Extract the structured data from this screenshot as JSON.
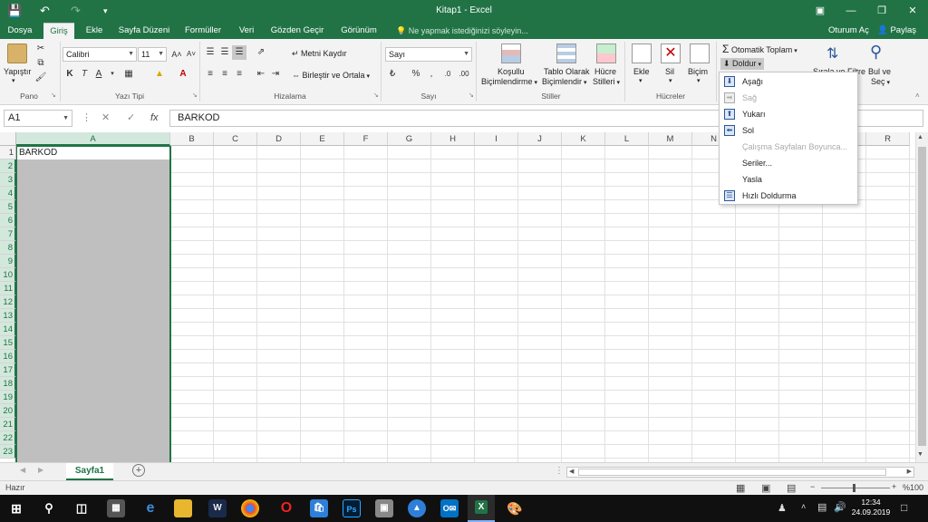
{
  "titlebar": {
    "title": "Kitap1  -  Excel"
  },
  "ribbon_tabs": [
    "Dosya",
    "Giriş",
    "Ekle",
    "Sayfa Düzeni",
    "Formüller",
    "Veri",
    "Gözden Geçir",
    "Görünüm"
  ],
  "tell_me": "Ne yapmak istediğinizi söyleyin...",
  "signin": "Oturum Aç",
  "share": "Paylaş",
  "ribbon": {
    "paste": "Yapıştır",
    "clipboard_label": "Pano",
    "font_name": "Calibri",
    "font_size": "11",
    "bold": "K",
    "italic": "T",
    "underline": "A",
    "font_label": "Yazı Tipi",
    "wrap_text": "Metni Kaydır",
    "merge_center": "Birleştir ve Ortala",
    "alignment_label": "Hizalama",
    "number_format": "Sayı",
    "number_label": "Sayı",
    "conditional_1": "Koşullu",
    "conditional_2": "Biçimlendirme",
    "table_1": "Tablo Olarak",
    "table_2": "Biçimlendir",
    "cellstyles_1": "Hücre",
    "cellstyles_2": "Stilleri",
    "styles_label": "Stiller",
    "insert": "Ekle",
    "delete": "Sil",
    "format": "Biçim",
    "cells_label": "Hücreler",
    "autosum": "Otomatik Toplam",
    "fill": "Doldur",
    "sortfilter": "Sırala ve Filtre",
    "find_1": "Bul ve",
    "find_2": "Seç"
  },
  "formula": {
    "namebox": "A1",
    "fx": "fx",
    "value": "BARKOD"
  },
  "columns": [
    "A",
    "B",
    "C",
    "D",
    "E",
    "F",
    "G",
    "H",
    "I",
    "J",
    "K",
    "L",
    "M",
    "N",
    "O",
    "P",
    "Q",
    "R"
  ],
  "rows": [
    "1",
    "2",
    "3",
    "4",
    "5",
    "6",
    "7",
    "8",
    "9",
    "10",
    "11",
    "12",
    "13",
    "14",
    "15",
    "16",
    "17",
    "18",
    "19",
    "20",
    "21",
    "22",
    "23"
  ],
  "cells": {
    "A1": "BARKOD"
  },
  "fill_menu": [
    {
      "label": "Aşağı",
      "disabled": false
    },
    {
      "label": "Sağ",
      "disabled": true
    },
    {
      "label": "Yukarı",
      "disabled": false
    },
    {
      "label": "Sol",
      "disabled": false
    },
    {
      "label": "Çalışma Sayfaları Boyunca...",
      "disabled": true
    },
    {
      "label": "Seriler...",
      "disabled": false
    },
    {
      "label": "Yasla",
      "disabled": false
    },
    {
      "label": "Hızlı Doldurma",
      "disabled": false
    }
  ],
  "sheet_tab": "Sayfa1",
  "status": {
    "ready": "Hazır",
    "zoom": "%100"
  },
  "clock": {
    "time": "12:34",
    "date": "24.09.2019"
  }
}
